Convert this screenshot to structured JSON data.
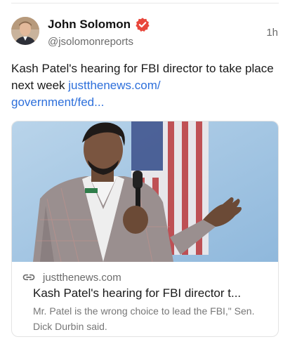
{
  "post": {
    "author_name": "John Solomon",
    "author_handle": "@jsolomonreports",
    "timestamp": "1h",
    "verified_icon": "verified-badge-icon",
    "text": "Kash Patel's hearing for FBI director to take place next week ",
    "link_text": "justthenews.com/\ngovernment/fed..."
  },
  "card": {
    "link_icon": "link-icon",
    "domain": "justthenews.com",
    "title": "Kash Patel's hearing for FBI director t...",
    "description": "Mr. Patel is the wrong choice to lead the FBI,\" Sen. Dick Durbin said."
  },
  "colors": {
    "link": "#2d6fdb",
    "verified": "#e8473c",
    "muted_text": "#6b6b6b"
  }
}
